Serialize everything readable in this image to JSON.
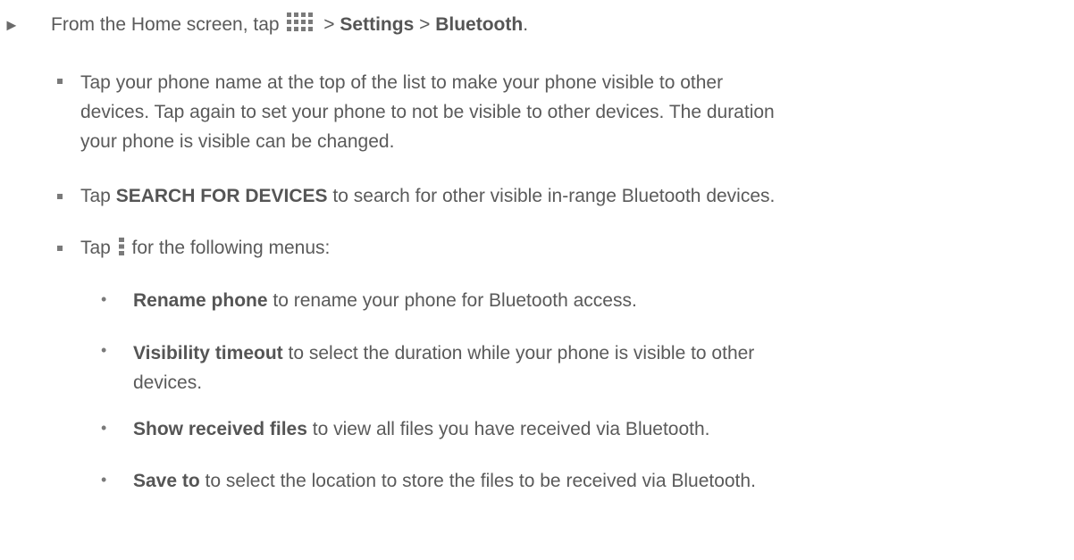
{
  "step": {
    "arrow": "►",
    "prefix": "From the Home screen, tap",
    "sep1": ">",
    "settings": "Settings",
    "sep2": ">",
    "bluetooth": "Bluetooth",
    "end": ".",
    "icon": "apps-grid-icon"
  },
  "bullets": {
    "visible": {
      "line1": "Tap your phone name at the top of the list to make your phone visible to other",
      "line2": "devices. Tap again to set your phone to not be visible to other devices. The duration",
      "line3": "your phone is visible can be changed."
    },
    "search": {
      "tap": "Tap",
      "bold": "SEARCH FOR DEVICES",
      "rest": "to search for other visible in-range Bluetooth devices."
    },
    "menu": {
      "tap": "Tap",
      "icon": "menu-icon",
      "rest": "for the following menus:"
    }
  },
  "menus": [
    {
      "bold": "Rename phone",
      "rest": "to rename your phone for Bluetooth access."
    },
    {
      "bold": "Visibility timeout",
      "rest": "to select the duration while your phone is visible to other",
      "rest2": "devices."
    },
    {
      "bold": "Show received files",
      "rest": "to view all files you have received via Bluetooth."
    },
    {
      "bold": "Save to",
      "rest": "to select the location to store the files to be received via Bluetooth."
    }
  ],
  "colors": {
    "text": "#5a5a5a",
    "icon": "#7a7a7a"
  }
}
